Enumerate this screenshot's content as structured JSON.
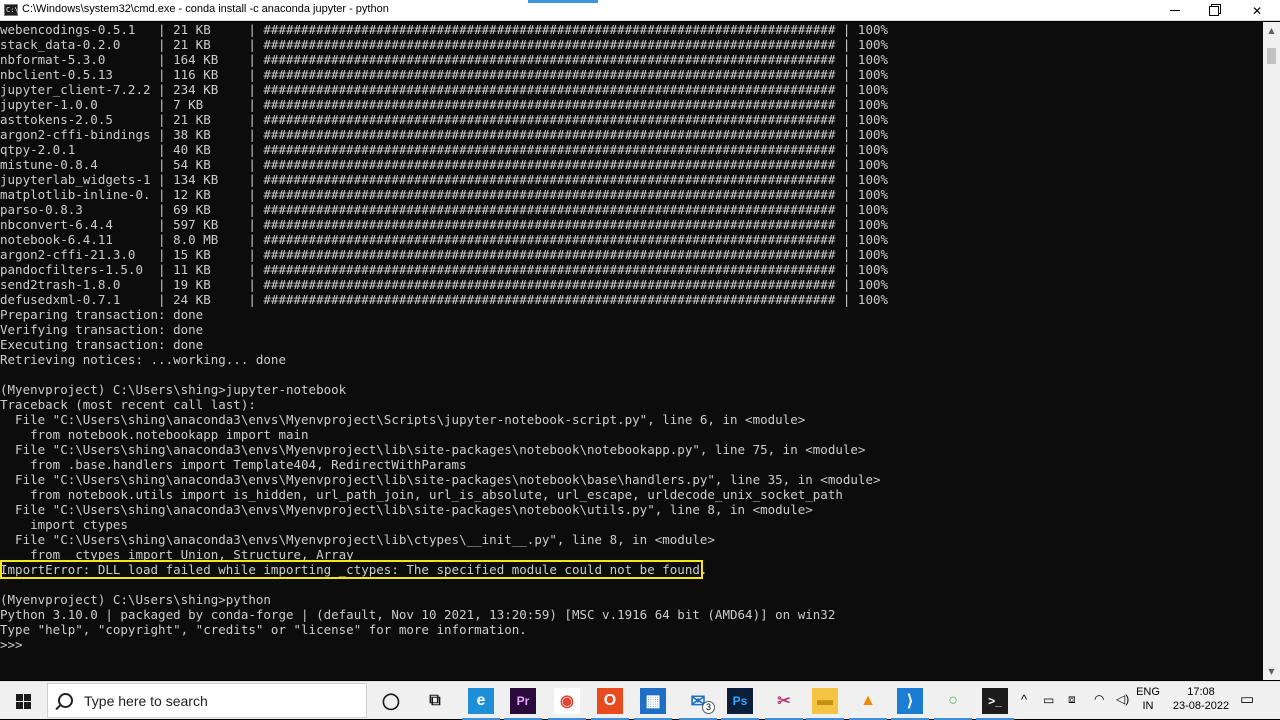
{
  "window": {
    "icon_label": "C:\\",
    "title": "C:\\Windows\\system32\\cmd.exe - conda  install -c anaconda jupyter - python",
    "controls": {
      "minimize": "minimize",
      "maximize": "maximize",
      "close": "✕"
    }
  },
  "console": {
    "lines": [
      "webencodings-0.5.1   | 21 KB     | ############################################################################ | 100%",
      "stack_data-0.2.0     | 21 KB     | ############################################################################ | 100%",
      "nbformat-5.3.0       | 164 KB    | ############################################################################ | 100%",
      "nbclient-0.5.13      | 116 KB    | ############################################################################ | 100%",
      "jupyter_client-7.2.2 | 234 KB    | ############################################################################ | 100%",
      "jupyter-1.0.0        | 7 KB      | ############################################################################ | 100%",
      "asttokens-2.0.5      | 21 KB     | ############################################################################ | 100%",
      "argon2-cffi-bindings | 38 KB     | ############################################################################ | 100%",
      "qtpy-2.0.1           | 40 KB     | ############################################################################ | 100%",
      "mistune-0.8.4        | 54 KB     | ############################################################################ | 100%",
      "jupyterlab_widgets-1 | 134 KB    | ############################################################################ | 100%",
      "matplotlib-inline-0. | 12 KB     | ############################################################################ | 100%",
      "parso-0.8.3          | 69 KB     | ############################################################################ | 100%",
      "nbconvert-6.4.4      | 597 KB    | ############################################################################ | 100%",
      "notebook-6.4.11      | 8.0 MB    | ############################################################################ | 100%",
      "argon2-cffi-21.3.0   | 15 KB     | ############################################################################ | 100%",
      "pandocfilters-1.5.0  | 11 KB     | ############################################################################ | 100%",
      "send2trash-1.8.0     | 19 KB     | ############################################################################ | 100%",
      "defusedxml-0.7.1     | 24 KB     | ############################################################################ | 100%",
      "Preparing transaction: done",
      "Verifying transaction: done",
      "Executing transaction: done",
      "Retrieving notices: ...working... done",
      "",
      "(Myenvproject) C:\\Users\\shing>jupyter-notebook",
      "Traceback (most recent call last):",
      "  File \"C:\\Users\\shing\\anaconda3\\envs\\Myenvproject\\Scripts\\jupyter-notebook-script.py\", line 6, in <module>",
      "    from notebook.notebookapp import main",
      "  File \"C:\\Users\\shing\\anaconda3\\envs\\Myenvproject\\lib\\site-packages\\notebook\\notebookapp.py\", line 75, in <module>",
      "    from .base.handlers import Template404, RedirectWithParams",
      "  File \"C:\\Users\\shing\\anaconda3\\envs\\Myenvproject\\lib\\site-packages\\notebook\\base\\handlers.py\", line 35, in <module>",
      "    from notebook.utils import is_hidden, url_path_join, url_is_absolute, url_escape, urldecode_unix_socket_path",
      "  File \"C:\\Users\\shing\\anaconda3\\envs\\Myenvproject\\lib\\site-packages\\notebook\\utils.py\", line 8, in <module>",
      "    import ctypes",
      "  File \"C:\\Users\\shing\\anaconda3\\envs\\Myenvproject\\lib\\ctypes\\__init__.py\", line 8, in <module>",
      "    from _ctypes import Union, Structure, Array",
      "ImportError: DLL load failed while importing _ctypes: The specified module could not be found.",
      "",
      "(Myenvproject) C:\\Users\\shing>python",
      "Python 3.10.0 | packaged by conda-forge | (default, Nov 10 2021, 13:20:59) [MSC v.1916 64 bit (AMD64)] on win32",
      "Type \"help\", \"copyright\", \"credits\" or \"license\" for more information.",
      ">>>"
    ],
    "highlight_color": "#f4e518"
  },
  "taskbar": {
    "search_placeholder": "Type here to search",
    "mail_badge": "3",
    "apps": [
      {
        "name": "cortana-icon",
        "glyph": "◯",
        "bg": "transparent",
        "fg": "#1a1a1a"
      },
      {
        "name": "task-view-icon",
        "glyph": "⧉",
        "bg": "transparent",
        "fg": "#1a1a1a"
      },
      {
        "name": "edge-icon",
        "glyph": "e",
        "bg": "#1e8fd6",
        "fg": "#ffffff"
      },
      {
        "name": "premiere-pro-icon",
        "glyph": "Pr",
        "bg": "#2a0a3a",
        "fg": "#e7a6ff"
      },
      {
        "name": "chrome-icon",
        "glyph": "◉",
        "bg": "#ffffff",
        "fg": "#db4437"
      },
      {
        "name": "office-icon",
        "glyph": "O",
        "bg": "#e84b1e",
        "fg": "#ffffff"
      },
      {
        "name": "store-icon",
        "glyph": "▦",
        "bg": "#1f6fc5",
        "fg": "#ffffff"
      },
      {
        "name": "mail-icon",
        "glyph": "✉",
        "bg": "transparent",
        "fg": "#1f6fc5"
      },
      {
        "name": "photoshop-icon",
        "glyph": "Ps",
        "bg": "#0b1f3b",
        "fg": "#31a8ff"
      },
      {
        "name": "snipping-tool-icon",
        "glyph": "✂",
        "bg": "transparent",
        "fg": "#b04070"
      },
      {
        "name": "file-explorer-icon",
        "glyph": "▬",
        "bg": "#f4c545",
        "fg": "#c78f10"
      },
      {
        "name": "vlc-icon",
        "glyph": "▲",
        "bg": "transparent",
        "fg": "#f08a00"
      },
      {
        "name": "vscode-icon",
        "glyph": "⟩",
        "bg": "#1a7fd4",
        "fg": "#ffffff"
      },
      {
        "name": "circle-app-icon",
        "glyph": "○",
        "bg": "transparent",
        "fg": "#3cb34a"
      },
      {
        "name": "cmd-icon",
        "glyph": ">_",
        "bg": "#1c1c1c",
        "fg": "#ffffff"
      }
    ],
    "tray": {
      "chevron": "^",
      "language": "ENG",
      "region": "IN",
      "time": "17:08",
      "date": "23-08-2022"
    }
  }
}
